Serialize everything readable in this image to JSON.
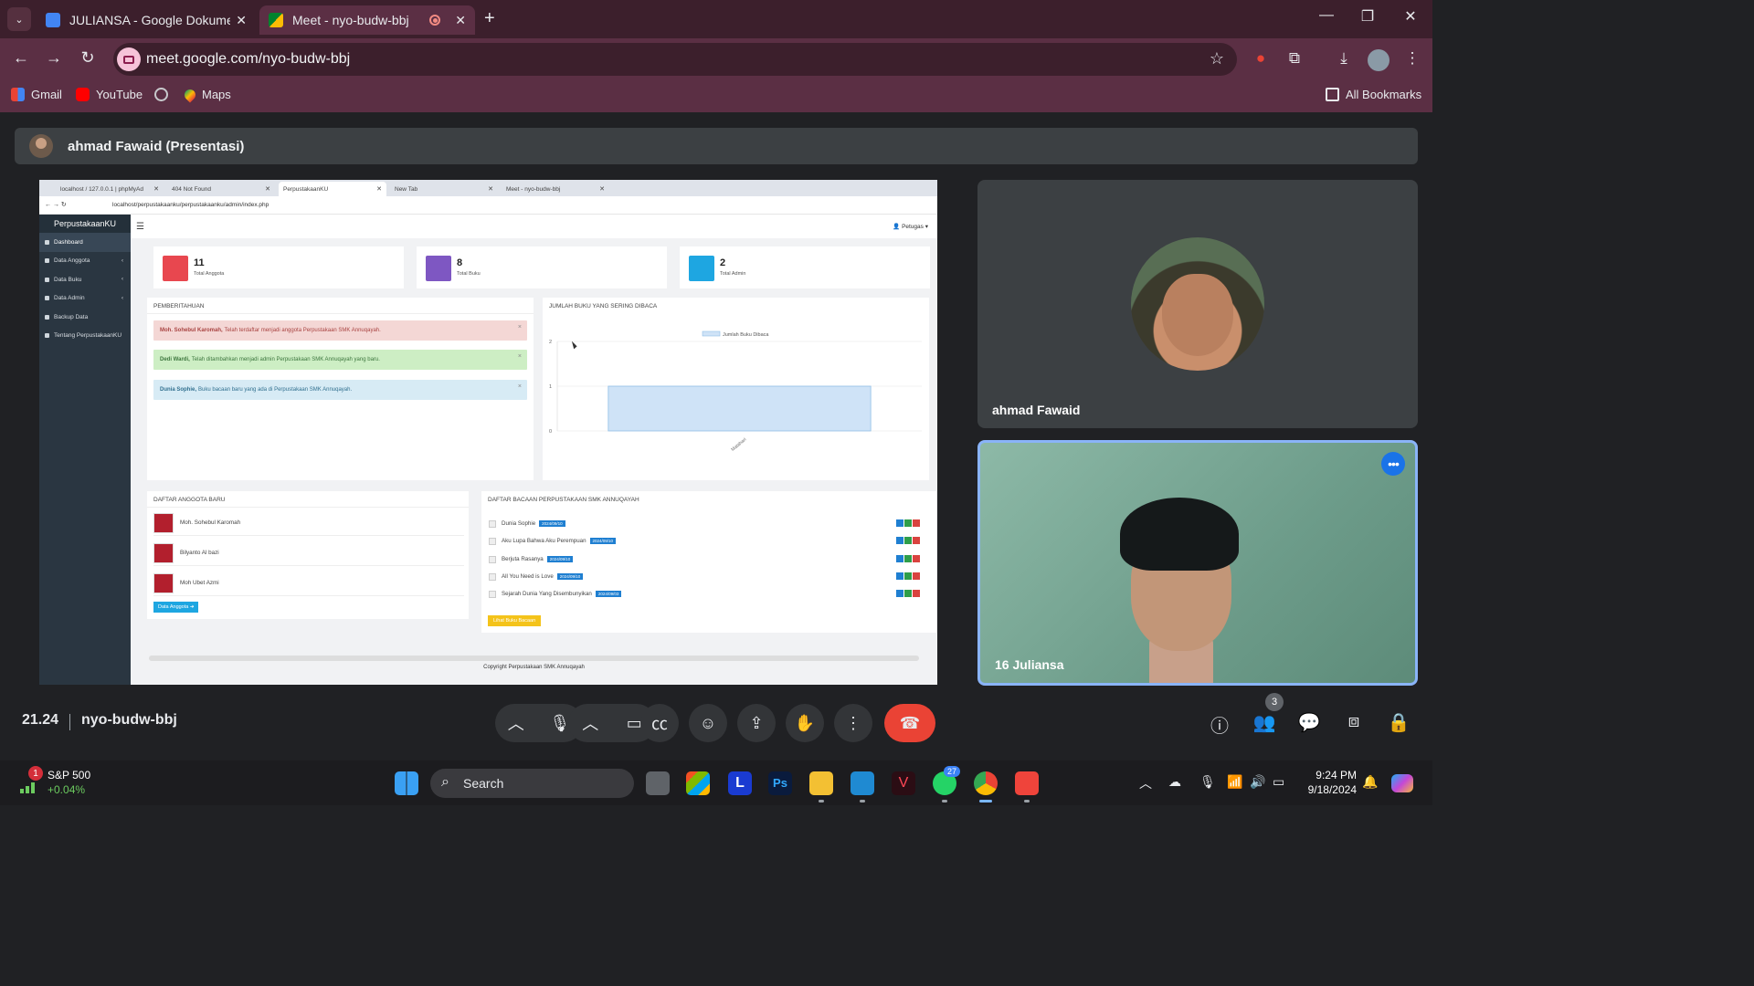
{
  "browser": {
    "tabs": [
      {
        "title": "JULIANSA - Google Dokumen",
        "active": false
      },
      {
        "title": "Meet - nyo-budw-bbj",
        "active": true
      }
    ],
    "url": "meet.google.com/nyo-budw-bbj",
    "bookmarks": [
      "Gmail",
      "YouTube",
      "Maps"
    ],
    "all_bookmarks": "All Bookmarks"
  },
  "meet": {
    "presenter_label": "ahmad Fawaid (Presentasi)",
    "participants": [
      {
        "name": "ahmad Fawaid"
      },
      {
        "name": "16 Juliansa"
      }
    ],
    "time": "21.24",
    "meeting_code": "nyo-budw-bbj",
    "people_count": "3"
  },
  "shared_screen": {
    "tabs": [
      "localhost / 127.0.0.1 | phpMyAd",
      "404 Not Found",
      "PerpustakaanKU",
      "New Tab",
      "Meet - nyo-budw-bbj"
    ],
    "url": "localhost/perpustakaanku/perpustakaanku/admin/index.php",
    "brand": "PerpustakaanKU",
    "menu": [
      "Dashboard",
      "Data Anggota",
      "Data Buku",
      "Data Admin",
      "Backup Data",
      "Tentang PerpustakaanKU"
    ],
    "user_menu": "Petugas",
    "stats": [
      {
        "value": "11",
        "label": "Total Anggota",
        "color": "#e8474f"
      },
      {
        "value": "8",
        "label": "Total Buku",
        "color": "#7e57c2"
      },
      {
        "value": "2",
        "label": "Total Admin",
        "color": "#1ea6e1"
      }
    ],
    "notifications_title": "PEMBERITAHUAN",
    "notifications": [
      {
        "bold": "Moh. Sohebul Karomah,",
        "text": "Telah terdaftar menjadi anggota Perpustakaan SMK Annuqayah.",
        "bg": "#f4d7d5",
        "fg": "#a94442"
      },
      {
        "bold": "Dedi Wardi,",
        "text": "Telah ditambahkan menjadi admin Perpustakaan SMK Annuqayah yang baru.",
        "bg": "#cdeec4",
        "fg": "#3c763d"
      },
      {
        "bold": "Dunia Sophie,",
        "text": "Buku bacaan baru yang ada di Perpustakaan SMK Annuqayah.",
        "bg": "#d7ebf5",
        "fg": "#31708f"
      }
    ],
    "chart_panel_title": "JUMLAH BUKU YANG SERING DIBACA",
    "chart_data": {
      "type": "bar",
      "categories": [
        "Matahari"
      ],
      "series": [
        {
          "name": "Jumlah Buku Dibaca",
          "values": [
            1
          ]
        }
      ],
      "ylim": [
        0,
        2
      ],
      "yticks": [
        "0",
        "1",
        "2"
      ]
    },
    "members_title": "DAFTAR ANGGOTA BARU",
    "members": [
      "Moh. Sohebul Karomah",
      "Bilyanto Al bazi",
      "Moh Ubet Azmi"
    ],
    "members_button": "Data Anggota",
    "books_title": "DAFTAR BACAAN PERPUSTAKAAN SMK ANNUQAYAH",
    "books": [
      {
        "title": "Dunia Sophie",
        "date": "2024/09/10"
      },
      {
        "title": "Aku Lupa Bahwa Aku Perempuan",
        "date": "2024/09/10"
      },
      {
        "title": "Berjuta Rasanya",
        "date": "2024/09/10"
      },
      {
        "title": "All You Need is Love",
        "date": "2024/09/10"
      },
      {
        "title": "Sejarah Dunia Yang Disembunyikan",
        "date": "2024/09/03"
      }
    ],
    "books_button": "Lihat Buku Bacaan",
    "footer": "Copyright Perpustakaan SMK Annuqayah"
  },
  "taskbar": {
    "ticker_name": "S&P 500",
    "ticker_change": "+0.04%",
    "ticker_badge": "1",
    "search": "Search",
    "whatsapp_badge": "27",
    "time": "9:24 PM",
    "date": "9/18/2024"
  },
  "colors": {
    "meet_bg": "#202124",
    "end_call": "#ea4335",
    "active_speaker": "#8ab4f8"
  }
}
